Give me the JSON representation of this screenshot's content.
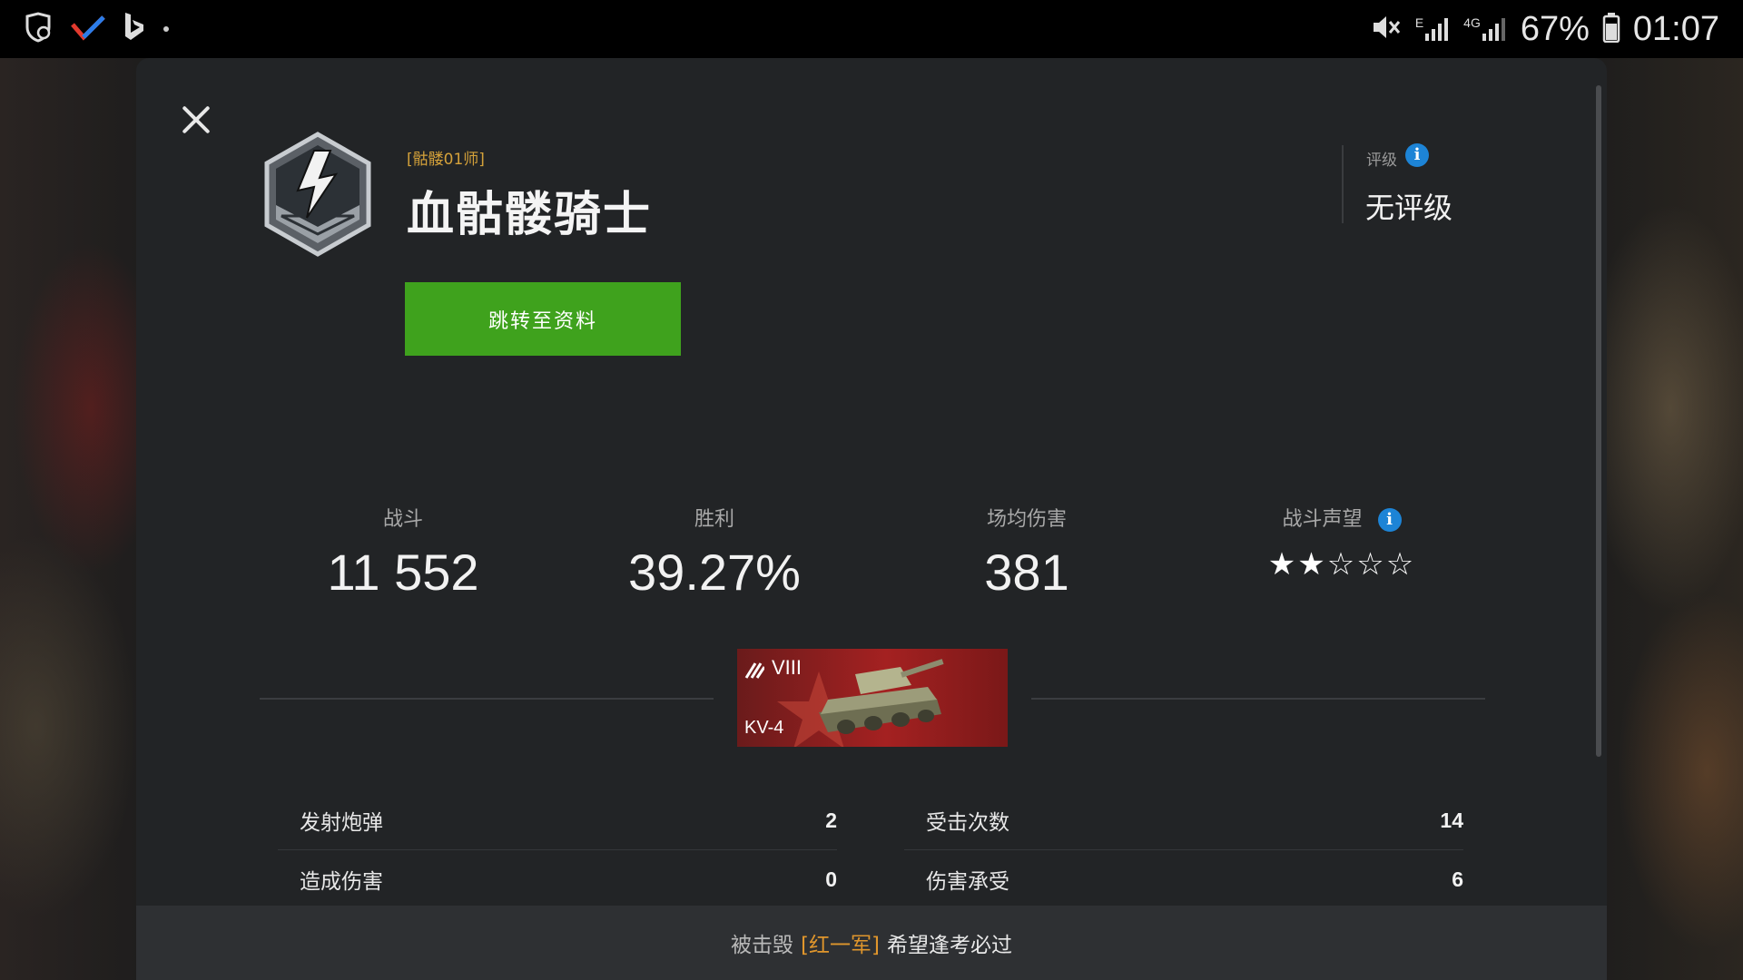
{
  "status_bar": {
    "battery": "67%",
    "time": "01:07",
    "network_1": "E",
    "network_2": "4G"
  },
  "header": {
    "clan_tag": "[骷髅01师]",
    "player_name": "血骷髅骑士",
    "profile_button": "跳转至资料",
    "rating_label": "评级",
    "rating_value": "无评级"
  },
  "stats": [
    {
      "label": "战斗",
      "value": "11 552"
    },
    {
      "label": "胜利",
      "value": "39.27%"
    },
    {
      "label": "场均伤害",
      "value": "381"
    },
    {
      "label": "战斗声望",
      "stars_filled": 2,
      "stars_total": 5,
      "value": "★★☆☆☆"
    }
  ],
  "tank": {
    "tier": "VIII",
    "name": "KV-4"
  },
  "details_left": [
    {
      "label": "发射炮弹",
      "value": "2"
    },
    {
      "label": "造成伤害",
      "value": "0"
    }
  ],
  "details_right": [
    {
      "label": "受击次数",
      "value": "14"
    },
    {
      "label": "伤害承受",
      "value": "6"
    }
  ],
  "footer": {
    "prefix": "被击毁",
    "clan_tag": "[红一军]",
    "killer": "希望逢考必过"
  },
  "colors": {
    "accent_green": "#3fa21d",
    "clan_gold": "#d4a13a",
    "info_blue": "#1d84d6"
  }
}
